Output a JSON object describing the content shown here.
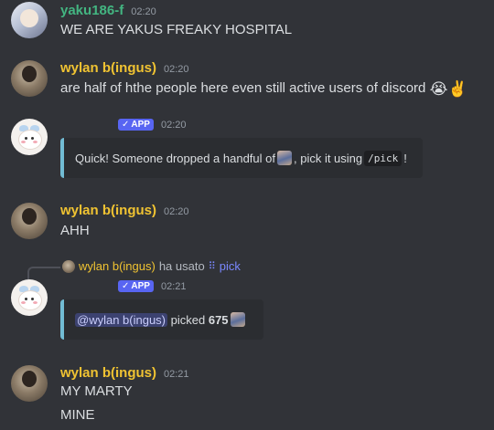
{
  "messages": [
    {
      "author": "yaku186-f",
      "time": "02:20",
      "text": "WE ARE YAKUS FREAKY HOSPITAL"
    },
    {
      "author": "wylan b(ingus)",
      "time": "02:20",
      "text": "are half of hthe people here even still active users of discord",
      "emojis": [
        "😭",
        "✌️"
      ]
    },
    {
      "author": "",
      "badge": "APP",
      "time": "02:20",
      "embed": {
        "text_before": "Quick! Someone dropped a handful of",
        "text_middle": ", pick it using",
        "command": "/pick",
        "text_after": "!"
      }
    },
    {
      "author": "wylan b(ingus)",
      "time": "02:20",
      "text": "AHH"
    },
    {
      "reply": {
        "author": "wylan b(ingus)",
        "text": "ha usato",
        "command_icon": "⠿",
        "command": "pick"
      },
      "author": "",
      "badge": "APP",
      "time": "02:21",
      "embed": {
        "mention": "@wylan b(ingus)",
        "text": "picked",
        "number": "675"
      }
    },
    {
      "author": "wylan b(ingus)",
      "time": "02:21",
      "lines": [
        "MY MARTY",
        "MINE"
      ]
    }
  ],
  "colors": {
    "background": "#313338",
    "yaku_name": "#43b581",
    "wylan_name": "#f0c332",
    "app_badge": "#5865f2",
    "embed_border": "#72bcd4"
  },
  "icons": {
    "checkmark": "checkmark-icon",
    "command": "slash-command-icon"
  }
}
